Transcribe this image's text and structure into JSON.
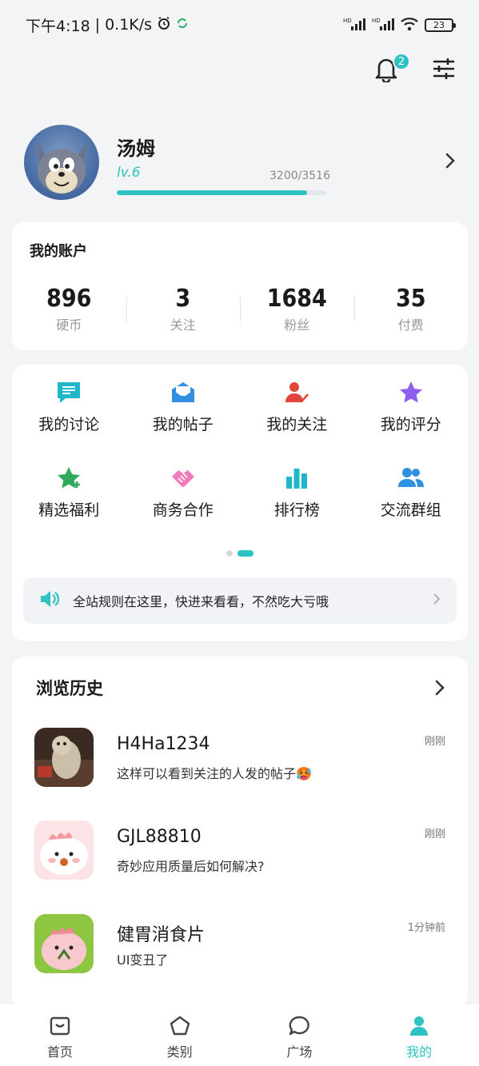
{
  "status_bar": {
    "time": "下午4:18",
    "speed": "0.1K/s",
    "battery": "23"
  },
  "header": {
    "notification_count": "2"
  },
  "profile": {
    "name": "汤姆",
    "level": "lv.6",
    "exp_text": "3200/3516",
    "exp_progress": 0.91
  },
  "account": {
    "title": "我的账户",
    "stats": [
      {
        "value": "896",
        "label": "硬币"
      },
      {
        "value": "3",
        "label": "关注"
      },
      {
        "value": "1684",
        "label": "粉丝"
      },
      {
        "value": "35",
        "label": "付费"
      }
    ]
  },
  "menu": {
    "items": [
      {
        "label": "我的讨论",
        "icon": "chat-icon",
        "color": "#1fb7c9"
      },
      {
        "label": "我的帖子",
        "icon": "mail-icon",
        "color": "#2f8fe0"
      },
      {
        "label": "我的关注",
        "icon": "user-check-icon",
        "color": "#e0443a"
      },
      {
        "label": "我的评分",
        "icon": "star-icon",
        "color": "#8f5ff2"
      },
      {
        "label": "精选福利",
        "icon": "star-plus-icon",
        "color": "#2fa95a"
      },
      {
        "label": "商务合作",
        "icon": "handshake-icon",
        "color": "#f07bbd"
      },
      {
        "label": "排行榜",
        "icon": "bar-chart-icon",
        "color": "#1fb7c9"
      },
      {
        "label": "交流群组",
        "icon": "group-icon",
        "color": "#2f8fe0"
      }
    ],
    "notice": "全站规则在这里，快进来看看，不然吃大亏哦"
  },
  "history": {
    "title": "浏览历史",
    "items": [
      {
        "name": "H4Ha1234",
        "message": "这样可以看到关注的人发的帖子🥵",
        "time": "刚刚"
      },
      {
        "name": "GJL88810",
        "message": "奇妙应用质量后如何解决?",
        "time": "刚刚"
      },
      {
        "name": "健胃消食片",
        "message": "UI变丑了",
        "time": "1分钟前"
      }
    ]
  },
  "tabs": [
    {
      "label": "首页",
      "icon": "home-icon"
    },
    {
      "label": "类别",
      "icon": "pentagon-icon"
    },
    {
      "label": "广场",
      "icon": "chat-bubble-icon"
    },
    {
      "label": "我的",
      "icon": "person-icon"
    }
  ],
  "colors": {
    "accent": "#2ec2c2"
  }
}
